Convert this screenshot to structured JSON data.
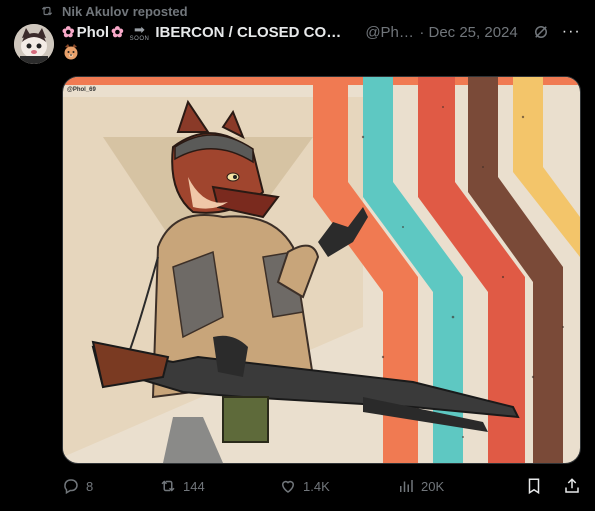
{
  "repost": {
    "user": "Nik Akulov",
    "suffix": "reposted"
  },
  "author": {
    "name": "Phol",
    "title": "IBERCON / CLOSED COM…",
    "handle": "@Pho…",
    "date": "· Dec 25, 2024",
    "soon_label": "SOON"
  },
  "media": {
    "watermark": "@Phol_69"
  },
  "actions": {
    "replies": "8",
    "reposts": "144",
    "likes": "1.4K",
    "views": "20K"
  },
  "colors": {
    "accent_gray": "#71767b",
    "text": "#e7e9ea",
    "background": "#000000"
  },
  "icons": [
    "repost-icon",
    "avatar",
    "soon-arrow-icon",
    "grok-icon",
    "more-icon",
    "dog-emoji",
    "reply-icon",
    "like-icon",
    "views-icon",
    "bookmark-icon",
    "share-icon"
  ]
}
